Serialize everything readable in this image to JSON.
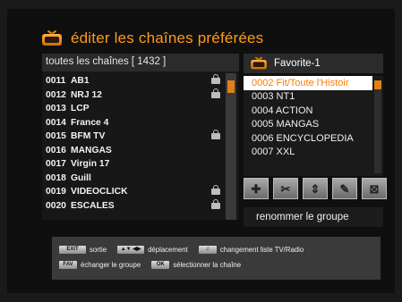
{
  "title": "éditer les chaînes préférées",
  "left_panel": {
    "header": "toutes les chaînes [ 1432 ]",
    "channels": [
      {
        "num": "0011",
        "name": "AB1",
        "locked": true
      },
      {
        "num": "0012",
        "name": "NRJ 12",
        "locked": true
      },
      {
        "num": "0013",
        "name": "LCP",
        "locked": false
      },
      {
        "num": "0014",
        "name": "France 4",
        "locked": false
      },
      {
        "num": "0015",
        "name": "BFM TV",
        "locked": true
      },
      {
        "num": "0016",
        "name": "MANGAS",
        "locked": false
      },
      {
        "num": "0017",
        "name": "Virgin 17",
        "locked": false
      },
      {
        "num": "0018",
        "name": "Guill",
        "locked": false
      },
      {
        "num": "0019",
        "name": "VIDEOCLICK",
        "locked": true
      },
      {
        "num": "0020",
        "name": "ESCALES",
        "locked": true
      }
    ]
  },
  "right_panel": {
    "header": "Favorite-1",
    "favorites": [
      {
        "text": "0002 Fit/Toute l'Histoir",
        "selected": true
      },
      {
        "text": "0003 NT1",
        "selected": false
      },
      {
        "text": "0004 ACTION",
        "selected": false
      },
      {
        "text": "0005 MANGAS",
        "selected": false
      },
      {
        "text": "0006 ENCYCLOPEDIA",
        "selected": false
      },
      {
        "text": "0007 XXL",
        "selected": false
      }
    ],
    "buttons": [
      {
        "name": "add-channel-button",
        "icon": "✚"
      },
      {
        "name": "cut-channel-button",
        "icon": "✂"
      },
      {
        "name": "move-channel-button",
        "icon": "⇕"
      },
      {
        "name": "edit-group-button",
        "icon": "✎"
      },
      {
        "name": "delete-channel-button",
        "icon": "⊠"
      }
    ],
    "rename_label": "renommer le groupe"
  },
  "help": {
    "line1": [
      {
        "key": "EXIT",
        "text": "sortie"
      },
      {
        "key": "▲▼ ◀▶",
        "text": "déplacement"
      },
      {
        "key": "♫",
        "text": "changement liste TV/Radio"
      }
    ],
    "line2": [
      {
        "key": "FAV",
        "text": "échanger le groupe"
      },
      {
        "key": "OK",
        "text": "sélectionner la chaîne"
      }
    ]
  },
  "colors": {
    "accent": "#ff9a1a",
    "selected_text": "#ff7a00",
    "scroll_thumb": "#e0801a"
  }
}
